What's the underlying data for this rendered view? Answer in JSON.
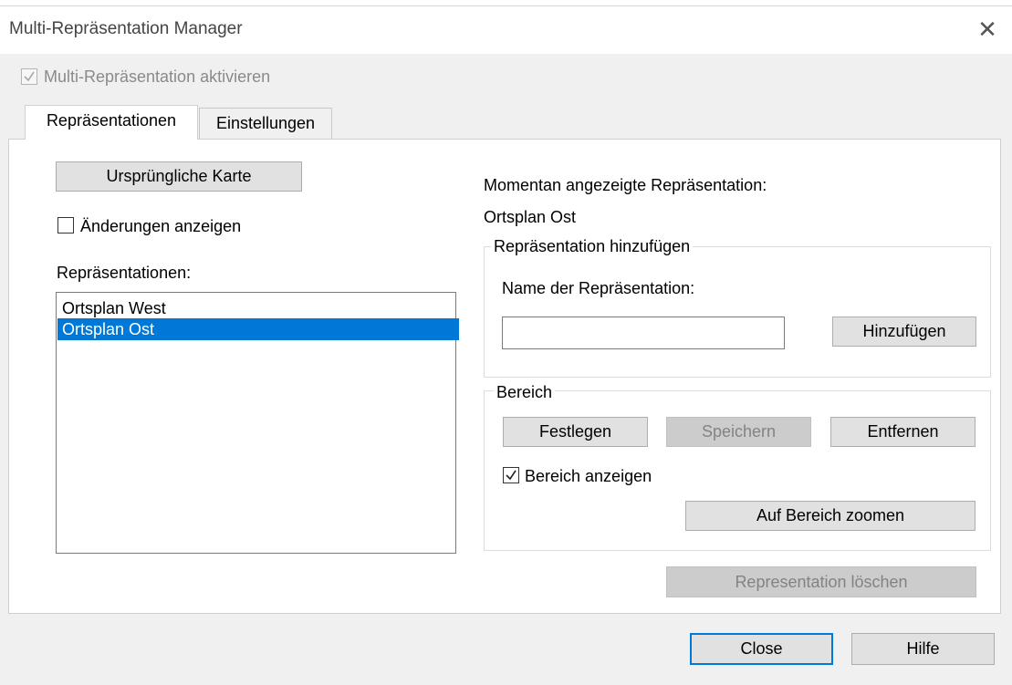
{
  "window": {
    "title": "Multi-Repräsentation Manager",
    "close_glyph": "✕"
  },
  "enable_checkbox": {
    "label": "Multi-Repräsentation aktivieren",
    "checked": true,
    "enabled": false
  },
  "tabs": [
    {
      "label": "Repräsentationen",
      "active": true
    },
    {
      "label": "Einstellungen",
      "active": false
    }
  ],
  "left": {
    "original_map_button": "Ursprüngliche Karte",
    "show_changes": {
      "label": "Änderungen anzeigen",
      "checked": false
    },
    "list_label": "Repräsentationen:",
    "list_items": [
      {
        "label": "Ortsplan West",
        "selected": false
      },
      {
        "label": "Ortsplan Ost",
        "selected": true
      }
    ]
  },
  "right": {
    "current_label": "Momentan angezeigte Repräsentation:",
    "current_value": "Ortsplan Ost",
    "add_group": {
      "title": "Repräsentation hinzufügen",
      "name_label": "Name der Repräsentation:",
      "name_value": "",
      "add_button": "Hinzufügen"
    },
    "area_group": {
      "title": "Bereich",
      "set_button": "Festlegen",
      "save_button": "Speichern",
      "remove_button": "Entfernen",
      "show_area": {
        "label": "Bereich anzeigen",
        "checked": true
      },
      "zoom_button": "Auf Bereich zoomen"
    },
    "delete_button": "Representation löschen"
  },
  "footer": {
    "close_button": "Close",
    "help_button": "Hilfe"
  },
  "colors": {
    "selection": "#0078d7",
    "default_button_border": "#0078d7",
    "window_bg": "#f0f0f0"
  }
}
